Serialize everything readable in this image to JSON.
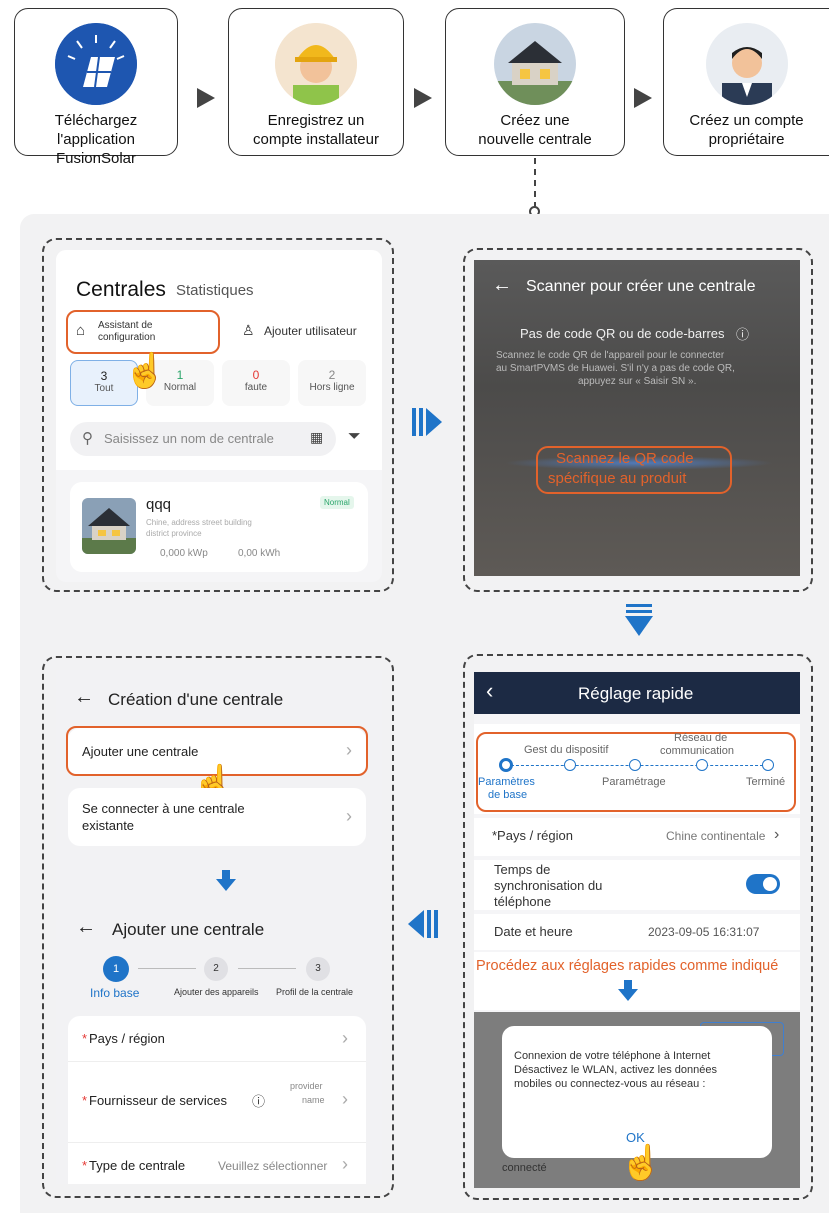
{
  "flow": {
    "step1": "Téléchargez l'application FusionSolar",
    "step1_line1": "Téléchargez",
    "step1_line2": "l'application FusionSolar",
    "step2_line1": "Enregistrez un",
    "step2_line2": "compte installateur",
    "step3_line1": "Créez une",
    "step3_line2": "nouvelle centrale",
    "step4_line1": "Créez un compte",
    "step4_line2": "propriétaire"
  },
  "screen1": {
    "title": "Centrales",
    "stats_tab": "Statistiques",
    "assistant_line1": "Assistant de",
    "assistant_line2": "configuration",
    "add_user": "Ajouter utilisateur",
    "filters": [
      {
        "count": "3",
        "label": "Tout",
        "color": "#222"
      },
      {
        "count": "1",
        "label": "Normal",
        "color": "#2aa56a"
      },
      {
        "count": "0",
        "label": "faute",
        "color": "#e53935"
      },
      {
        "count": "2",
        "label": "Hors ligne",
        "color": "#888"
      }
    ],
    "search_placeholder": "Saisissez un nom de centrale",
    "plant_name": "qqq",
    "plant_status": "Normal",
    "plant_addr_line1": "Chine, address street building",
    "plant_addr_line2": "district province",
    "plant_power": "0,000 kWp",
    "plant_energy": "0,00 kWh"
  },
  "screen2": {
    "title": "Scanner pour créer une centrale",
    "noqr": "Pas de code QR ou de code-barres",
    "hint_line1": "Scannez le code QR de l'appareil pour le connecter",
    "hint_line2": "au SmartPVMS de Huawei. S'il n'y a pas de code QR,",
    "hint_line3": "appuyez sur « Saisir SN ».",
    "scan_line1": "Scannez le QR code",
    "scan_line2": "spécifique au produit"
  },
  "screen3": {
    "title": "Réglage rapide",
    "steps_top1": "Gest du dispositif",
    "steps_top2_line1": "Réseau de",
    "steps_top2_line2": "communication",
    "steps_bottom1_line1": "Paramètres",
    "steps_bottom1_line2": "de base",
    "steps_bottom2": "Paramétrage",
    "steps_bottom3": "Terminé",
    "country_label": "*Pays / région",
    "country_value": "Chine continentale",
    "sync_line1": "Temps de",
    "sync_line2": "synchronisation du",
    "sync_line3": "téléphone",
    "date_label": "Date et heure",
    "date_value": "2023-09-05 16:31:07",
    "note": "Procédez aux réglages rapides comme indiqué",
    "dialog_line1": "Connexion de votre téléphone à Internet",
    "dialog_line2": "Désactivez le WLAN, activez les données",
    "dialog_line3": "mobiles ou connectez-vous au réseau :",
    "dialog_ok": "OK",
    "bg_text": "connecté"
  },
  "screen4": {
    "title": "Création d'une centrale",
    "add_plant": "Ajouter une centrale",
    "connect_line1": "Se connecter à une centrale",
    "connect_line2": "existante",
    "title2": "Ajouter une centrale",
    "steps": [
      {
        "num": "1",
        "label": "Info base"
      },
      {
        "num": "2",
        "label": "Ajouter des appareils"
      },
      {
        "num": "3",
        "label": "Profil de la centrale"
      }
    ],
    "country": "Pays / région",
    "provider": "Fournisseur de services",
    "plant_type": "Type de centrale",
    "plant_type_placeholder": "Veuillez sélectionner",
    "provider_value_line1": "provider",
    "provider_value_line2": "name"
  },
  "colors": {
    "accent": "#1f74c8",
    "orange": "#e2622b",
    "navy": "#1c2a44"
  }
}
